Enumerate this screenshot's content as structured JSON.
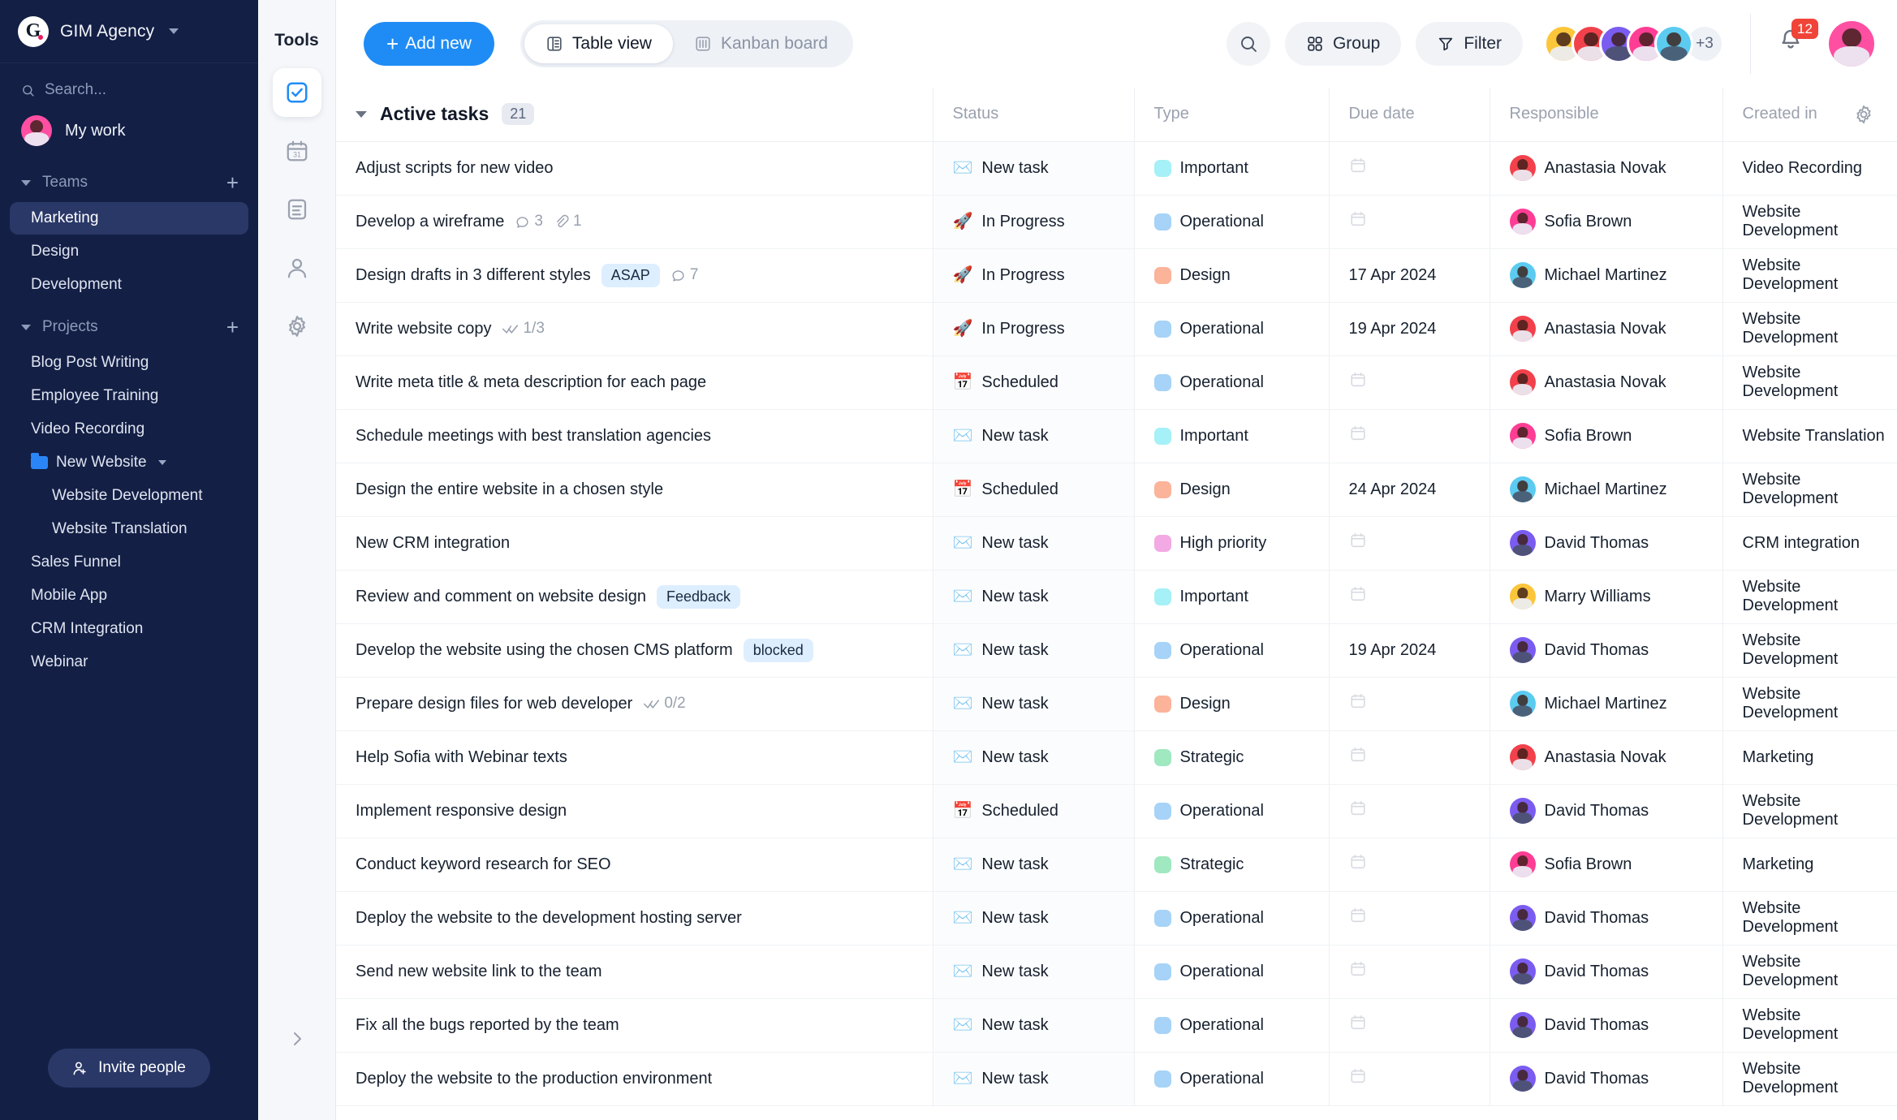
{
  "sidebar": {
    "brand": {
      "logo_letter": "G",
      "name": "GIM Agency",
      "caret_icon": "chevron-down-icon"
    },
    "search": {
      "placeholder": "Search...",
      "icon": "search-icon"
    },
    "my_work": {
      "label": "My work",
      "avatar_color": "#ff4fa3"
    },
    "teams": {
      "title": "Teams",
      "add_label": "+",
      "items": [
        {
          "label": "Marketing",
          "active": true
        },
        {
          "label": "Design",
          "active": false
        },
        {
          "label": "Development",
          "active": false
        }
      ]
    },
    "projects": {
      "title": "Projects",
      "add_label": "+",
      "items": [
        {
          "label": "Blog Post Writing",
          "type": "item"
        },
        {
          "label": "Employee Training",
          "type": "item"
        },
        {
          "label": "Video Recording",
          "type": "item"
        },
        {
          "label": "New Website",
          "type": "folder"
        },
        {
          "label": "Website Development",
          "type": "sub"
        },
        {
          "label": "Website Translation",
          "type": "sub"
        },
        {
          "label": "Sales Funnel",
          "type": "item"
        },
        {
          "label": "Mobile App",
          "type": "item"
        },
        {
          "label": "CRM Integration",
          "type": "item"
        },
        {
          "label": "Webinar",
          "type": "item"
        }
      ]
    },
    "invite": {
      "label": "Invite people",
      "icon": "user-plus-icon"
    }
  },
  "tools": {
    "title": "Tools",
    "items": [
      {
        "name": "tasks-icon",
        "selected": true
      },
      {
        "name": "calendar-icon",
        "selected": false
      },
      {
        "name": "notes-icon",
        "selected": false
      },
      {
        "name": "contacts-icon",
        "selected": false
      },
      {
        "name": "settings-icon",
        "selected": false
      }
    ],
    "collapse_icon": "chevron-right-icon"
  },
  "topbar": {
    "add_new": "Add new",
    "add_new_plus": "+",
    "views": [
      {
        "label": "Table view",
        "icon": "table-icon",
        "active": true
      },
      {
        "label": "Kanban board",
        "icon": "kanban-icon",
        "active": false
      }
    ],
    "search_icon": "search-icon",
    "group": {
      "label": "Group",
      "icon": "grid-icon"
    },
    "filter": {
      "label": "Filter",
      "icon": "funnel-icon"
    },
    "avatars": [
      {
        "color": "#fcc63a",
        "dark": false
      },
      {
        "color": "#f2414b",
        "dark": false
      },
      {
        "color": "#7b5cf0",
        "dark": true
      },
      {
        "color": "#ff3d94",
        "dark": false
      },
      {
        "color": "#5ccbf0",
        "dark": true
      }
    ],
    "overflow_label": "+3",
    "notifications": {
      "count": "12",
      "icon": "bell-icon"
    },
    "me_avatar_color": "#ff4fa3"
  },
  "table": {
    "group": {
      "title": "Active tasks",
      "count": "21",
      "caret_icon": "chevron-down-icon"
    },
    "settings_icon": "gear-icon",
    "columns": [
      "Status",
      "Type",
      "Due date",
      "Responsible",
      "Created in"
    ],
    "accent": "#1f8cf5",
    "type_colors": {
      "Important": "#a6f0f7",
      "Operational": "#a6d3f7",
      "Design": "#fbb39a",
      "High priority": "#f3a9e3",
      "Strategic": "#9fe8c0"
    },
    "status_emoji": {
      "New task": "✉️",
      "In Progress": "🚀",
      "Scheduled": "📅"
    },
    "people": {
      "Anastasia Novak": "#f2414b",
      "Sofia Brown": "#ff3d94",
      "Michael Martinez": "#5ccbf0",
      "David Thomas": "#7b5cf0",
      "Marry Williams": "#fcc63a"
    },
    "rows": [
      {
        "task": "Adjust scripts for new video",
        "tag": "",
        "meta": "",
        "status": "New task",
        "type": "Important",
        "due": "",
        "responsible": "Anastasia Novak",
        "created": "Video Recording"
      },
      {
        "task": "Develop a wireframe",
        "tag": "",
        "meta": "comments:3|attach:1",
        "status": "In Progress",
        "type": "Operational",
        "due": "",
        "responsible": "Sofia Brown",
        "created": "Website Development"
      },
      {
        "task": "Design drafts in 3 different styles",
        "tag": "ASAP",
        "meta": "comments:7",
        "status": "In Progress",
        "type": "Design",
        "due": "17 Apr 2024",
        "responsible": "Michael Martinez",
        "created": "Website Development"
      },
      {
        "task": "Write website copy",
        "tag": "",
        "meta": "checks:1/3",
        "status": "In Progress",
        "type": "Operational",
        "due": "19 Apr 2024",
        "responsible": "Anastasia Novak",
        "created": "Website Development"
      },
      {
        "task": "Write meta title & meta description for each page",
        "tag": "",
        "meta": "",
        "status": "Scheduled",
        "type": "Operational",
        "due": "",
        "responsible": "Anastasia Novak",
        "created": "Website Development"
      },
      {
        "task": "Schedule meetings with best translation agencies",
        "tag": "",
        "meta": "",
        "status": "New task",
        "type": "Important",
        "due": "",
        "responsible": "Sofia Brown",
        "created": "Website Translation"
      },
      {
        "task": "Design the entire website in a chosen style",
        "tag": "",
        "meta": "",
        "status": "Scheduled",
        "type": "Design",
        "due": "24 Apr 2024",
        "responsible": "Michael Martinez",
        "created": "Website Development"
      },
      {
        "task": "New CRM integration",
        "tag": "",
        "meta": "",
        "status": "New task",
        "type": "High priority",
        "due": "",
        "responsible": "David Thomas",
        "created": "CRM integration"
      },
      {
        "task": "Review and comment on website design",
        "tag": "Feedback",
        "meta": "",
        "status": "New task",
        "type": "Important",
        "due": "",
        "responsible": "Marry Williams",
        "created": "Website Development"
      },
      {
        "task": "Develop the website using the chosen CMS platform",
        "tag": "blocked",
        "meta": "",
        "status": "New task",
        "type": "Operational",
        "due": "19 Apr 2024",
        "responsible": "David Thomas",
        "created": "Website Development"
      },
      {
        "task": "Prepare design files for web developer",
        "tag": "",
        "meta": "checks:0/2",
        "status": "New task",
        "type": "Design",
        "due": "",
        "responsible": "Michael Martinez",
        "created": "Website Development"
      },
      {
        "task": "Help Sofia with Webinar texts",
        "tag": "",
        "meta": "",
        "status": "New task",
        "type": "Strategic",
        "due": "",
        "responsible": "Anastasia Novak",
        "created": "Marketing"
      },
      {
        "task": "Implement responsive design",
        "tag": "",
        "meta": "",
        "status": "Scheduled",
        "type": "Operational",
        "due": "",
        "responsible": "David Thomas",
        "created": "Website Development"
      },
      {
        "task": "Conduct keyword research for SEO",
        "tag": "",
        "meta": "",
        "status": "New task",
        "type": "Strategic",
        "due": "",
        "responsible": "Sofia Brown",
        "created": "Marketing"
      },
      {
        "task": "Deploy the website to the development hosting server",
        "tag": "",
        "meta": "",
        "status": "New task",
        "type": "Operational",
        "due": "",
        "responsible": "David Thomas",
        "created": "Website Development"
      },
      {
        "task": "Send new website link to the team",
        "tag": "",
        "meta": "",
        "status": "New task",
        "type": "Operational",
        "due": "",
        "responsible": "David Thomas",
        "created": "Website Development"
      },
      {
        "task": "Fix all the bugs reported by the team",
        "tag": "",
        "meta": "",
        "status": "New task",
        "type": "Operational",
        "due": "",
        "responsible": "David Thomas",
        "created": "Website Development"
      },
      {
        "task": "Deploy the website to the production environment",
        "tag": "",
        "meta": "",
        "status": "New task",
        "type": "Operational",
        "due": "",
        "responsible": "David Thomas",
        "created": "Website Development"
      }
    ]
  }
}
